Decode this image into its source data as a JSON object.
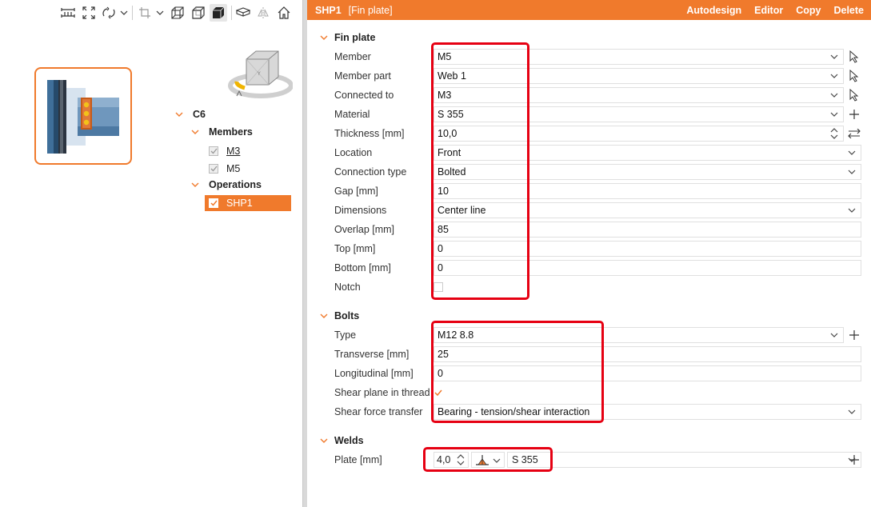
{
  "toolbar": {
    "icons": [
      "measure-icon",
      "fit-view-icon",
      "rotate-icon",
      "rotate-dropdown-icon",
      "crop-icon",
      "crop-dropdown-icon",
      "wireframe-cube-icon",
      "transparent-cube-icon",
      "solid-cube-icon",
      "section-plane-icon",
      "mirror-icon",
      "home-icon"
    ]
  },
  "tree": {
    "root": "C6",
    "members_label": "Members",
    "members": [
      "M3",
      "M5"
    ],
    "operations_label": "Operations",
    "operations": [
      "SHP1"
    ]
  },
  "header": {
    "title": "SHP1",
    "subtitle": "[Fin plate]",
    "actions": [
      "Autodesign",
      "Editor",
      "Copy",
      "Delete"
    ]
  },
  "fin_plate": {
    "section_label": "Fin plate",
    "rows": [
      {
        "label": "Member",
        "value": "M5"
      },
      {
        "label": "Member part",
        "value": "Web 1"
      },
      {
        "label": "Connected to",
        "value": "M3"
      },
      {
        "label": "Material",
        "value": "S 355"
      },
      {
        "label": "Thickness [mm]",
        "value": "10,0"
      },
      {
        "label": "Location",
        "value": "Front"
      },
      {
        "label": "Connection type",
        "value": "Bolted"
      },
      {
        "label": "Gap [mm]",
        "value": "10"
      },
      {
        "label": "Dimensions",
        "value": "Center line"
      },
      {
        "label": "Overlap [mm]",
        "value": "85"
      },
      {
        "label": "Top [mm]",
        "value": "0"
      },
      {
        "label": "Bottom [mm]",
        "value": "0"
      },
      {
        "label": "Notch",
        "value": ""
      }
    ]
  },
  "bolts": {
    "section_label": "Bolts",
    "rows": [
      {
        "label": "Type",
        "value": "M12 8.8"
      },
      {
        "label": "Transverse [mm]",
        "value": "25"
      },
      {
        "label": "Longitudinal [mm]",
        "value": "0"
      },
      {
        "label": "Shear plane in thread",
        "value": ""
      },
      {
        "label": "Shear force transfer",
        "value": "Bearing - tension/shear interaction"
      }
    ]
  },
  "welds": {
    "section_label": "Welds",
    "plate_label": "Plate [mm]",
    "size": "4,0",
    "material": "S 355"
  },
  "colors": {
    "accent": "#f07a2c",
    "highlight": "#e60012"
  }
}
